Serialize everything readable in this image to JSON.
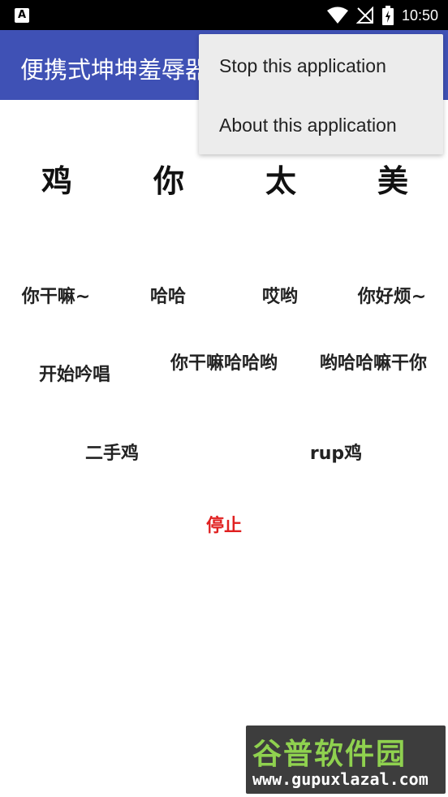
{
  "status_bar": {
    "time": "10:50",
    "left_icon": "A",
    "icons": [
      "wifi-icon",
      "no-signal-icon",
      "battery-icon"
    ]
  },
  "app_bar": {
    "title": "便携式坤坤羞辱器",
    "color": "#3f51b5"
  },
  "menu": {
    "items": [
      "Stop this application",
      "About this application"
    ]
  },
  "title_row": [
    "鸡",
    "你",
    "太",
    "美"
  ],
  "buttons_row1": [
    "你干嘛~",
    "哈哈",
    "哎哟",
    "你好烦~"
  ],
  "buttons_row2": [
    "开始吟唱",
    "你干嘛哈哈哟",
    "哟哈哈嘛干你"
  ],
  "buttons_row3": [
    "二手鸡",
    "rup鸡"
  ],
  "stop_button": {
    "label": "停止",
    "color": "#e02020"
  },
  "watermark": {
    "top": "谷普软件园",
    "bottom": "www.gupuxlazal.com"
  }
}
